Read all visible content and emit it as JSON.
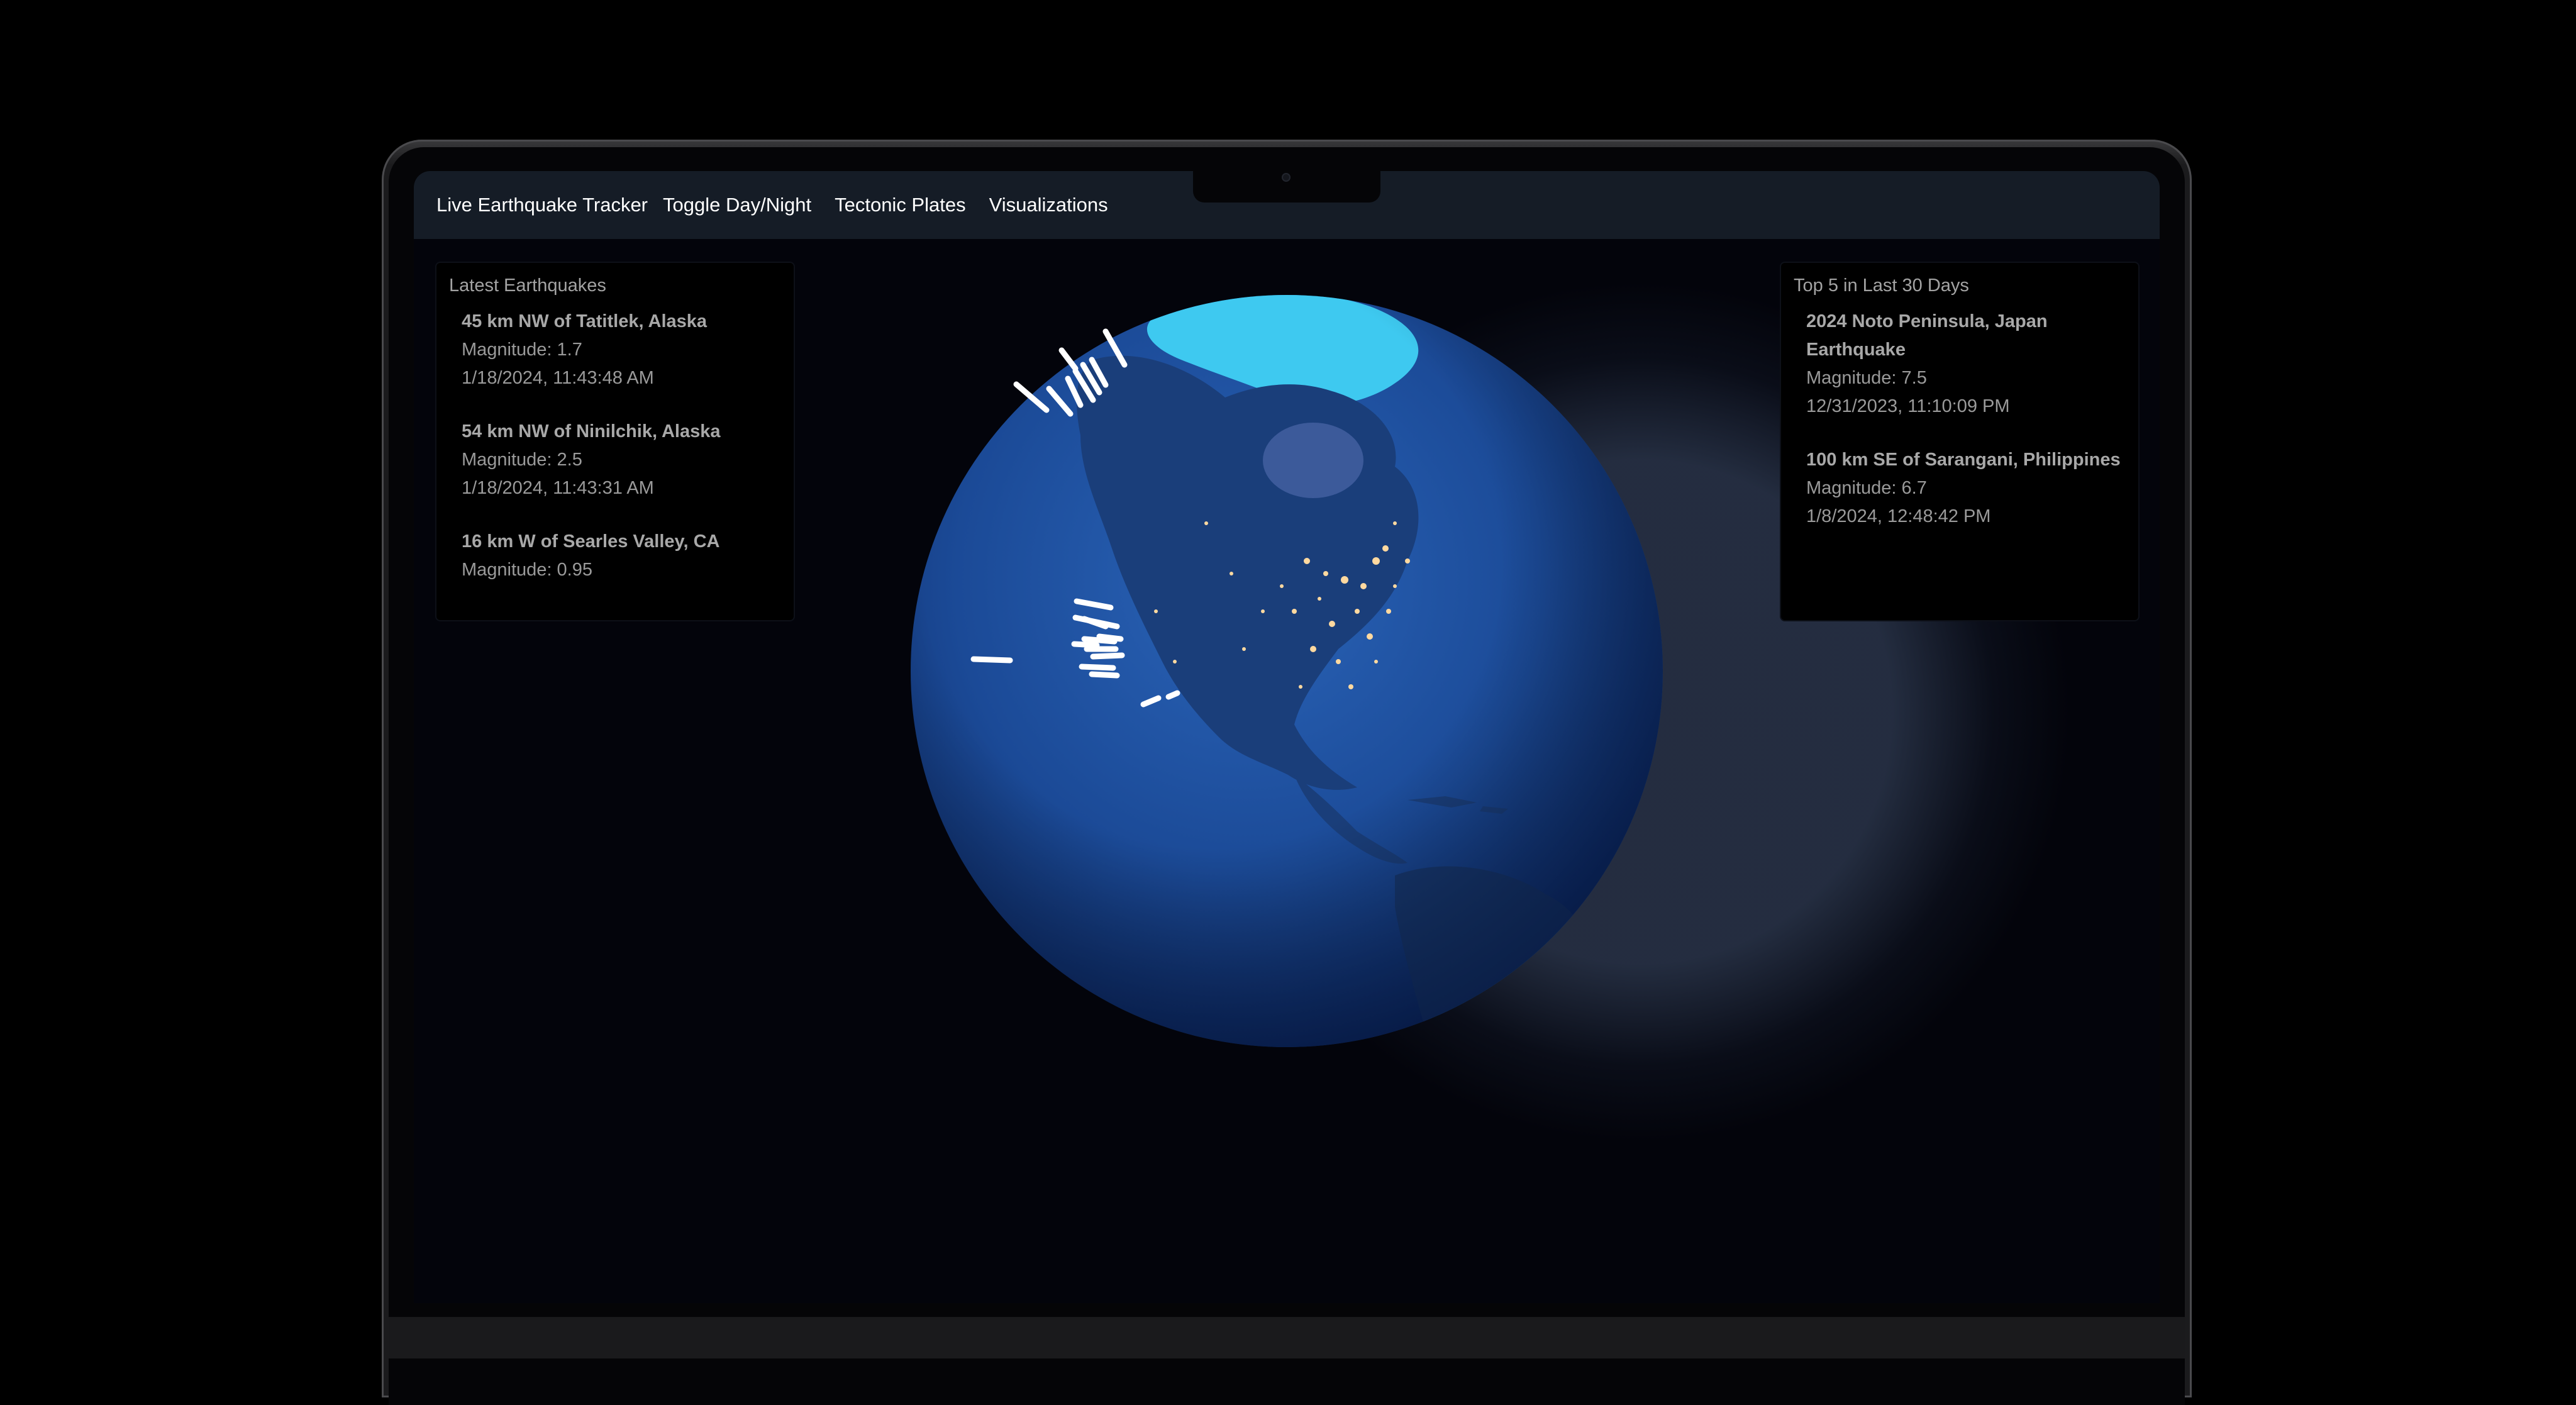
{
  "nav": {
    "brand": "Live Earthquake Tracker",
    "items": [
      "Toggle Day/Night",
      "Tectonic Plates",
      "Visualizations"
    ]
  },
  "latest": {
    "title": "Latest Earthquakes",
    "items": [
      {
        "place": "45 km NW of Tatitlek, Alaska",
        "magnitude": "Magnitude: 1.7",
        "time": "1/18/2024, 11:43:48 AM"
      },
      {
        "place": "54 km NW of Ninilchik, Alaska",
        "magnitude": "Magnitude: 2.5",
        "time": "1/18/2024, 11:43:31 AM"
      },
      {
        "place": "16 km W of Searles Valley, CA",
        "magnitude": "Magnitude: 0.95",
        "time": ""
      }
    ]
  },
  "top5": {
    "title": "Top 5 in Last 30 Days",
    "items": [
      {
        "place": "2024 Noto Peninsula, Japan Earthquake",
        "magnitude": "Magnitude: 7.5",
        "time": "12/31/2023, 11:10:09 PM"
      },
      {
        "place": "100 km SE of Sarangani, Philippines",
        "magnitude": "Magnitude: 6.7",
        "time": "1/8/2024, 12:48:42 PM"
      }
    ]
  },
  "colors": {
    "navbar": "#151c26",
    "screen": "#03040b",
    "ocean": "#1d4f9e",
    "ice": "#3ec9f0",
    "city_lights": "#ffd9a0",
    "quake_marker": "#ffffff"
  }
}
